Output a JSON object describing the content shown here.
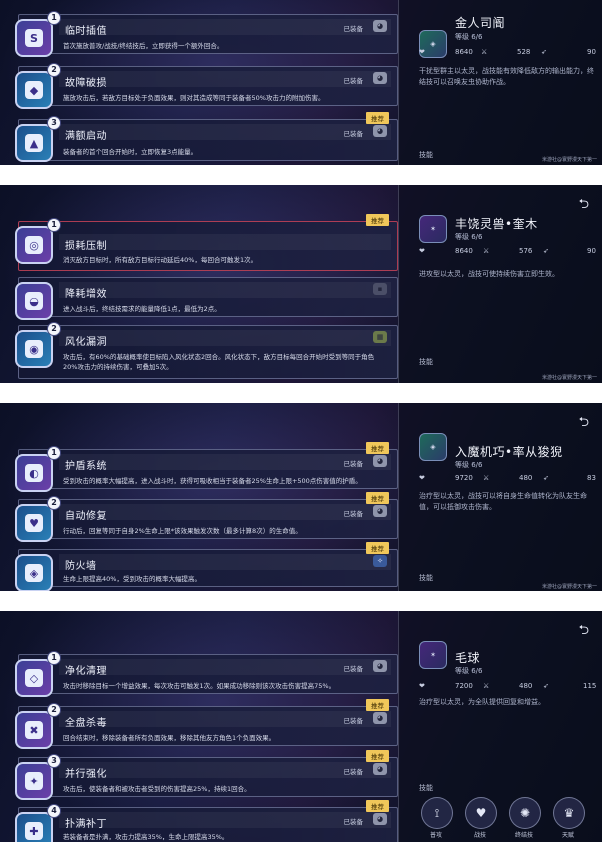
{
  "common": {
    "equipped_label": "已装备",
    "recommend_label": "推荐",
    "skills_label": "技能",
    "credit": "米游社@寰野漫天下第一",
    "back_icon": "⮌"
  },
  "panels": [
    {
      "cards": [
        {
          "num": "1",
          "title": "临时插值",
          "desc": "首次施放普攻/战技/终结技后，立即获得一个额外回合。",
          "equipped": true,
          "recommend": false
        },
        {
          "num": "2",
          "title": "故障破损",
          "desc": "施放攻击后，若敌方目标处于负面效果，则对其造成等同于装备者50%攻击力的附加伤害。",
          "equipped": true,
          "recommend": false
        },
        {
          "num": "3",
          "title": "满额启动",
          "desc": "装备者的首个回合开始时，立即恢复3点能量。",
          "equipped": true,
          "recommend": true
        }
      ],
      "profile": {
        "name": "金人司阍",
        "level": "等级 6/6",
        "hp": "8640",
        "atk": "528",
        "spd": "90",
        "desc": "干扰型群主以太灵，战技能有效降低敌方的输出能力，终结技可以召唤友虫协助作战。"
      }
    },
    {
      "cards": [
        {
          "num": "1",
          "title": "损耗压制",
          "desc": "消灭敌方目标时，所有敌方目标行动延后40%，每回合可触发1次。",
          "equipped": false,
          "recommend": true
        },
        {
          "num": "",
          "title": "降耗增效",
          "desc": "进入战斗后，终结技需求的能量降低1点，最低为2点。",
          "equipped": false,
          "recommend": false
        },
        {
          "num": "2",
          "title": "风化漏洞",
          "desc": "攻击后，有60%的基础概率使目标陷入风化状态2回合。风化状态下，敌方目标每回合开始时受到等同于角色20%攻击力的持续伤害，可叠加5次。",
          "equipped": false,
          "recommend": false
        }
      ],
      "profile": {
        "name": "丰饶灵兽•奎木",
        "level": "等级 6/6",
        "hp": "8640",
        "atk": "576",
        "spd": "90",
        "desc": "进攻型以太灵，战技可使持续伤害立即生效。"
      }
    },
    {
      "cards": [
        {
          "num": "1",
          "title": "护盾系统",
          "desc": "受到攻击的概率大幅提高，进入战斗时，获得可吸收相当于装备者25%生命上限+500点伤害值的护盾。",
          "equipped": true,
          "recommend": true
        },
        {
          "num": "2",
          "title": "自动修复",
          "desc": "行动后，回复等同于自身2%生命上限*该效果触发次数（最多计算8次）的生命值。",
          "equipped": true,
          "recommend": true
        },
        {
          "num": "",
          "title": "防火墙",
          "desc": "生命上限提高40%，受到攻击的概率大幅提高。",
          "equipped": false,
          "recommend": true
        }
      ],
      "profile": {
        "name": "入魔机巧•率从狻猊",
        "level": "等级 6/6",
        "hp": "9720",
        "atk": "480",
        "spd": "83",
        "desc": "治疗型以太灵，战技可以将自身生命值转化为队友生命值，可以抵御攻击伤害。"
      }
    },
    {
      "cards": [
        {
          "num": "1",
          "title": "净化清理",
          "desc": "攻击时移除目标一个增益效果，每次攻击可触发1次。如果成功移除则该次攻击伤害提高75%。",
          "equipped": true,
          "recommend": false
        },
        {
          "num": "2",
          "title": "全盘杀毒",
          "desc": "回合结束时，移除装备者所有负面效果，移除其他友方角色1个负面效果。",
          "equipped": true,
          "recommend": true
        },
        {
          "num": "3",
          "title": "并行强化",
          "desc": "攻击后，使装备者和被攻击者受到的伤害提高25%，持续1回合。",
          "equipped": true,
          "recommend": true
        },
        {
          "num": "4",
          "title": "扑满补丁",
          "desc": "若装备者是扑满，攻击力提高35%，生命上限提高35%。",
          "equipped": true,
          "recommend": true
        }
      ],
      "profile": {
        "name": "毛球",
        "level": "等级 6/6",
        "hp": "7200",
        "atk": "480",
        "spd": "115",
        "desc": "治疗型以太灵，为全队提供回复和增益。"
      },
      "skill_buttons": [
        {
          "label": "普攻",
          "icon": "claw-icon"
        },
        {
          "label": "战技",
          "icon": "heart-icon"
        },
        {
          "label": "终结技",
          "icon": "beast-icon"
        },
        {
          "label": "天赋",
          "icon": "talent-icon"
        }
      ]
    }
  ]
}
